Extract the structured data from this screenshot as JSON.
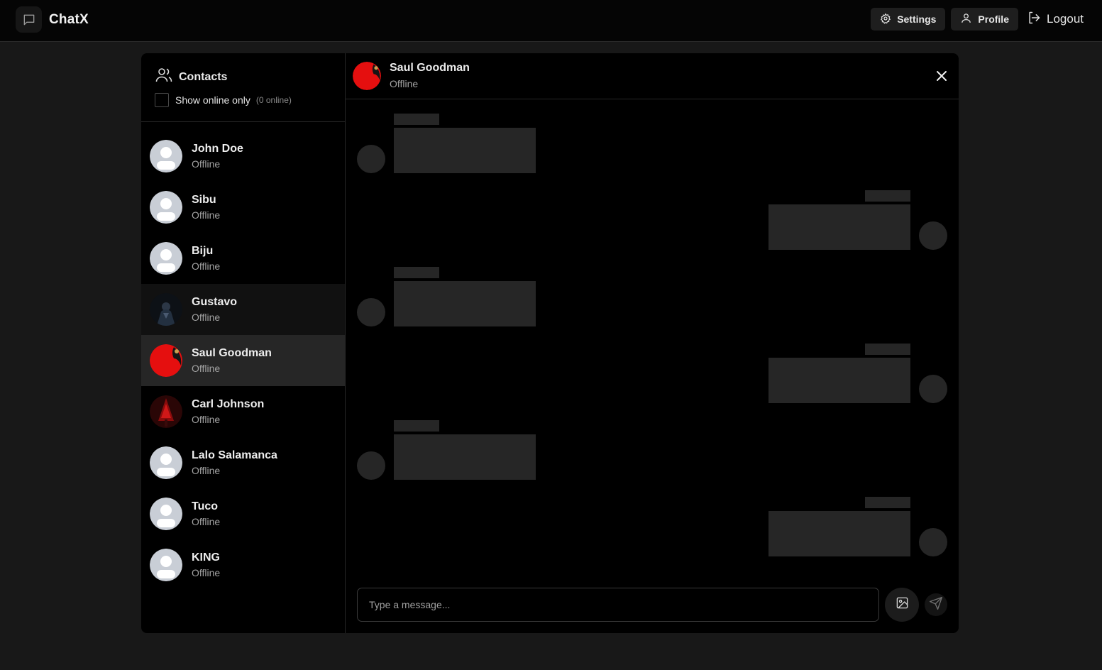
{
  "app": {
    "name": "ChatX"
  },
  "nav": {
    "settings_label": "Settings",
    "profile_label": "Profile",
    "logout_label": "Logout"
  },
  "sidebar": {
    "title": "Contacts",
    "filter_label": "Show online only",
    "online_count": "(0 online)",
    "contacts": [
      {
        "name": "John Doe",
        "status": "Offline",
        "avatar": "default-avatar"
      },
      {
        "name": "Sibu",
        "status": "Offline",
        "avatar": "default-avatar"
      },
      {
        "name": "Biju",
        "status": "Offline",
        "avatar": "default-avatar"
      },
      {
        "name": "Gustavo",
        "status": "Offline",
        "avatar": "dark-figure-photo"
      },
      {
        "name": "Saul Goodman",
        "status": "Offline",
        "avatar": "red-moon-photo",
        "selected": true
      },
      {
        "name": "Carl Johnson",
        "status": "Offline",
        "avatar": "red-tree-photo"
      },
      {
        "name": "Lalo Salamanca",
        "status": "Offline",
        "avatar": "default-avatar"
      },
      {
        "name": "Tuco",
        "status": "Offline",
        "avatar": "default-avatar"
      },
      {
        "name": "KING",
        "status": "Offline",
        "avatar": "default-avatar"
      }
    ]
  },
  "chat": {
    "contact_name": "Saul Goodman",
    "contact_status": "Offline",
    "composer_placeholder": "Type a message..."
  },
  "colors": {
    "background": "#181818",
    "panel": "#000000",
    "selected_row": "#262626",
    "skeleton": "#262626",
    "accent_red": "#e50f0f"
  }
}
